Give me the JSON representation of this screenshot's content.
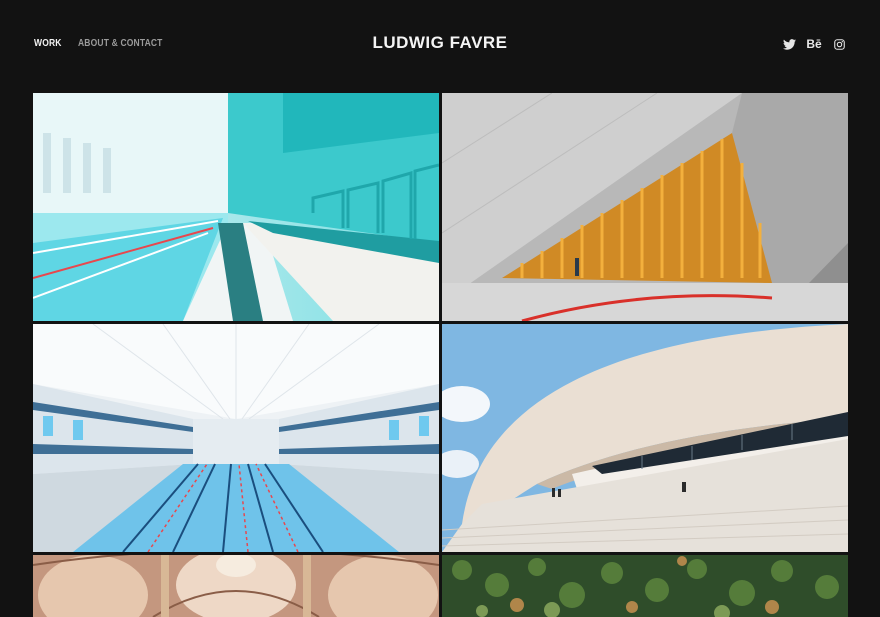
{
  "nav": {
    "work": "WORK",
    "about": "ABOUT & CONTACT"
  },
  "brand": "LUDWIG FAVRE",
  "social": {
    "icons": [
      "twitter-icon",
      "behance-icon",
      "instagram-icon"
    ],
    "behance_label": "Bē"
  },
  "gallery": {
    "tiles": [
      {
        "subject": "pool-hall-cyan",
        "palette": [
          "#34c7c9",
          "#a8f0ee",
          "#ffffff"
        ]
      },
      {
        "subject": "concrete-facade-orange-glass",
        "palette": [
          "#bdbdbd",
          "#e68a1b",
          "#d9302a"
        ]
      },
      {
        "subject": "indoor-pool-balconies",
        "palette": [
          "#f3f6f8",
          "#6fc9ef",
          "#1a5a8c"
        ]
      },
      {
        "subject": "white-curved-building",
        "palette": [
          "#efe7de",
          "#cfc2b4",
          "#7db4e0"
        ]
      },
      {
        "subject": "ornate-dome-ceiling",
        "palette": [
          "#c99c84",
          "#f0d9c7",
          "#7a5543"
        ]
      },
      {
        "subject": "forest-aerial",
        "palette": [
          "#2f4f2a",
          "#567d3a",
          "#b0864a"
        ]
      }
    ]
  },
  "colors": {
    "background": "#121212",
    "text": "#f4f4f4",
    "muted": "#9b9b9b"
  }
}
